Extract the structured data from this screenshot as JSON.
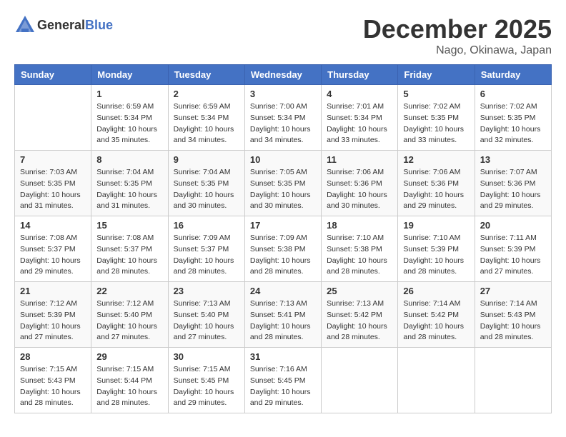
{
  "header": {
    "logo_general": "General",
    "logo_blue": "Blue",
    "month": "December 2025",
    "location": "Nago, Okinawa, Japan"
  },
  "weekdays": [
    "Sunday",
    "Monday",
    "Tuesday",
    "Wednesday",
    "Thursday",
    "Friday",
    "Saturday"
  ],
  "weeks": [
    [
      {
        "day": "",
        "sunrise": "",
        "sunset": "",
        "daylight": ""
      },
      {
        "day": "1",
        "sunrise": "6:59 AM",
        "sunset": "5:34 PM",
        "daylight": "10 hours and 35 minutes."
      },
      {
        "day": "2",
        "sunrise": "6:59 AM",
        "sunset": "5:34 PM",
        "daylight": "10 hours and 34 minutes."
      },
      {
        "day": "3",
        "sunrise": "7:00 AM",
        "sunset": "5:34 PM",
        "daylight": "10 hours and 34 minutes."
      },
      {
        "day": "4",
        "sunrise": "7:01 AM",
        "sunset": "5:34 PM",
        "daylight": "10 hours and 33 minutes."
      },
      {
        "day": "5",
        "sunrise": "7:02 AM",
        "sunset": "5:35 PM",
        "daylight": "10 hours and 33 minutes."
      },
      {
        "day": "6",
        "sunrise": "7:02 AM",
        "sunset": "5:35 PM",
        "daylight": "10 hours and 32 minutes."
      }
    ],
    [
      {
        "day": "7",
        "sunrise": "7:03 AM",
        "sunset": "5:35 PM",
        "daylight": "10 hours and 31 minutes."
      },
      {
        "day": "8",
        "sunrise": "7:04 AM",
        "sunset": "5:35 PM",
        "daylight": "10 hours and 31 minutes."
      },
      {
        "day": "9",
        "sunrise": "7:04 AM",
        "sunset": "5:35 PM",
        "daylight": "10 hours and 30 minutes."
      },
      {
        "day": "10",
        "sunrise": "7:05 AM",
        "sunset": "5:35 PM",
        "daylight": "10 hours and 30 minutes."
      },
      {
        "day": "11",
        "sunrise": "7:06 AM",
        "sunset": "5:36 PM",
        "daylight": "10 hours and 30 minutes."
      },
      {
        "day": "12",
        "sunrise": "7:06 AM",
        "sunset": "5:36 PM",
        "daylight": "10 hours and 29 minutes."
      },
      {
        "day": "13",
        "sunrise": "7:07 AM",
        "sunset": "5:36 PM",
        "daylight": "10 hours and 29 minutes."
      }
    ],
    [
      {
        "day": "14",
        "sunrise": "7:08 AM",
        "sunset": "5:37 PM",
        "daylight": "10 hours and 29 minutes."
      },
      {
        "day": "15",
        "sunrise": "7:08 AM",
        "sunset": "5:37 PM",
        "daylight": "10 hours and 28 minutes."
      },
      {
        "day": "16",
        "sunrise": "7:09 AM",
        "sunset": "5:37 PM",
        "daylight": "10 hours and 28 minutes."
      },
      {
        "day": "17",
        "sunrise": "7:09 AM",
        "sunset": "5:38 PM",
        "daylight": "10 hours and 28 minutes."
      },
      {
        "day": "18",
        "sunrise": "7:10 AM",
        "sunset": "5:38 PM",
        "daylight": "10 hours and 28 minutes."
      },
      {
        "day": "19",
        "sunrise": "7:10 AM",
        "sunset": "5:39 PM",
        "daylight": "10 hours and 28 minutes."
      },
      {
        "day": "20",
        "sunrise": "7:11 AM",
        "sunset": "5:39 PM",
        "daylight": "10 hours and 27 minutes."
      }
    ],
    [
      {
        "day": "21",
        "sunrise": "7:12 AM",
        "sunset": "5:39 PM",
        "daylight": "10 hours and 27 minutes."
      },
      {
        "day": "22",
        "sunrise": "7:12 AM",
        "sunset": "5:40 PM",
        "daylight": "10 hours and 27 minutes."
      },
      {
        "day": "23",
        "sunrise": "7:13 AM",
        "sunset": "5:40 PM",
        "daylight": "10 hours and 27 minutes."
      },
      {
        "day": "24",
        "sunrise": "7:13 AM",
        "sunset": "5:41 PM",
        "daylight": "10 hours and 28 minutes."
      },
      {
        "day": "25",
        "sunrise": "7:13 AM",
        "sunset": "5:42 PM",
        "daylight": "10 hours and 28 minutes."
      },
      {
        "day": "26",
        "sunrise": "7:14 AM",
        "sunset": "5:42 PM",
        "daylight": "10 hours and 28 minutes."
      },
      {
        "day": "27",
        "sunrise": "7:14 AM",
        "sunset": "5:43 PM",
        "daylight": "10 hours and 28 minutes."
      }
    ],
    [
      {
        "day": "28",
        "sunrise": "7:15 AM",
        "sunset": "5:43 PM",
        "daylight": "10 hours and 28 minutes."
      },
      {
        "day": "29",
        "sunrise": "7:15 AM",
        "sunset": "5:44 PM",
        "daylight": "10 hours and 28 minutes."
      },
      {
        "day": "30",
        "sunrise": "7:15 AM",
        "sunset": "5:45 PM",
        "daylight": "10 hours and 29 minutes."
      },
      {
        "day": "31",
        "sunrise": "7:16 AM",
        "sunset": "5:45 PM",
        "daylight": "10 hours and 29 minutes."
      },
      {
        "day": "",
        "sunrise": "",
        "sunset": "",
        "daylight": ""
      },
      {
        "day": "",
        "sunrise": "",
        "sunset": "",
        "daylight": ""
      },
      {
        "day": "",
        "sunrise": "",
        "sunset": "",
        "daylight": ""
      }
    ]
  ]
}
